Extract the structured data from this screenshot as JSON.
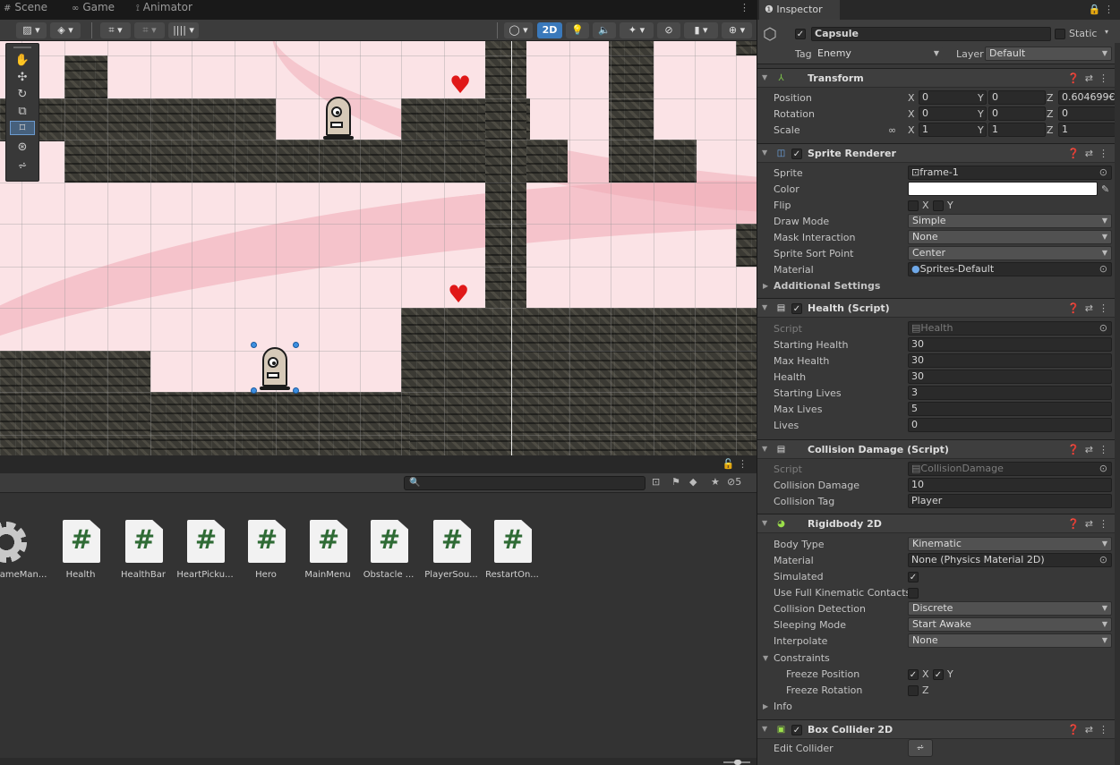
{
  "top_tabs": {
    "scene": "Scene",
    "game": "Game",
    "animator": "Animator"
  },
  "scene_toolbar": {
    "mode_2d": "2D",
    "gizmos_count": ""
  },
  "scene_tools": [
    "hand-tool",
    "move-tool",
    "rotate-tool",
    "scale-tool",
    "rect-tool",
    "transform-tool",
    "custom-tool"
  ],
  "project": {
    "search_placeholder": "",
    "hidden_count": "5",
    "assets": [
      {
        "name": "GameMan...",
        "icon": "gear-icon"
      },
      {
        "name": "Health",
        "icon": "script-icon"
      },
      {
        "name": "HealthBar",
        "icon": "script-icon"
      },
      {
        "name": "HeartPicku...",
        "icon": "script-icon"
      },
      {
        "name": "Hero",
        "icon": "script-icon"
      },
      {
        "name": "MainMenu",
        "icon": "script-icon"
      },
      {
        "name": "Obstacle ...",
        "icon": "script-icon"
      },
      {
        "name": "PlayerSou...",
        "icon": "script-icon"
      },
      {
        "name": "RestartOn...",
        "icon": "script-icon"
      }
    ]
  },
  "inspector": {
    "tab": "Inspector",
    "object_name": "Capsule",
    "static_label": "Static",
    "tag_label": "Tag",
    "tag_value": "Enemy",
    "layer_label": "Layer",
    "layer_value": "Default",
    "transform": {
      "title": "Transform",
      "position_label": "Position",
      "position": {
        "x": "0",
        "y": "0",
        "z": "0.604699€"
      },
      "rotation_label": "Rotation",
      "rotation": {
        "x": "0",
        "y": "0",
        "z": "0"
      },
      "scale_label": "Scale",
      "scale": {
        "x": "1",
        "y": "1",
        "z": "1"
      }
    },
    "sprite_renderer": {
      "title": "Sprite Renderer",
      "sprite_label": "Sprite",
      "sprite_value": "frame-1",
      "color_label": "Color",
      "color_value": "#ffffff",
      "flip_label": "Flip",
      "flip_x": "X",
      "flip_y": "Y",
      "draw_mode_label": "Draw Mode",
      "draw_mode": "Simple",
      "mask_label": "Mask Interaction",
      "mask": "None",
      "sort_point_label": "Sprite Sort Point",
      "sort_point": "Center",
      "material_label": "Material",
      "material": "Sprites-Default",
      "additional": "Additional Settings"
    },
    "health": {
      "title": "Health (Script)",
      "script_label": "Script",
      "script_value": "Health",
      "starting_health_label": "Starting Health",
      "starting_health": "30",
      "max_health_label": "Max Health",
      "max_health": "30",
      "health_label": "Health",
      "health_value": "30",
      "starting_lives_label": "Starting Lives",
      "starting_lives": "3",
      "max_lives_label": "Max Lives",
      "max_lives": "5",
      "lives_label": "Lives",
      "lives": "0"
    },
    "collision": {
      "title": "Collision Damage (Script)",
      "script_label": "Script",
      "script_value": "CollisionDamage",
      "damage_label": "Collision Damage",
      "damage": "10",
      "tag_label": "Collision Tag",
      "tag": "Player"
    },
    "rigidbody": {
      "title": "Rigidbody 2D",
      "body_type_label": "Body Type",
      "body_type": "Kinematic",
      "material_label": "Material",
      "material": "None (Physics Material 2D)",
      "simulated_label": "Simulated",
      "full_kinematic_label": "Use Full Kinematic Contacts",
      "detection_label": "Collision Detection",
      "detection": "Discrete",
      "sleeping_label": "Sleeping Mode",
      "sleeping": "Start Awake",
      "interpolate_label": "Interpolate",
      "interpolate": "None",
      "constraints_label": "Constraints",
      "freeze_pos_label": "Freeze Position",
      "fp_x": "X",
      "fp_y": "Y",
      "freeze_rot_label": "Freeze Rotation",
      "fr_z": "Z",
      "info_label": "Info"
    },
    "box_collider": {
      "title": "Box Collider 2D",
      "edit_label": "Edit Collider"
    }
  }
}
